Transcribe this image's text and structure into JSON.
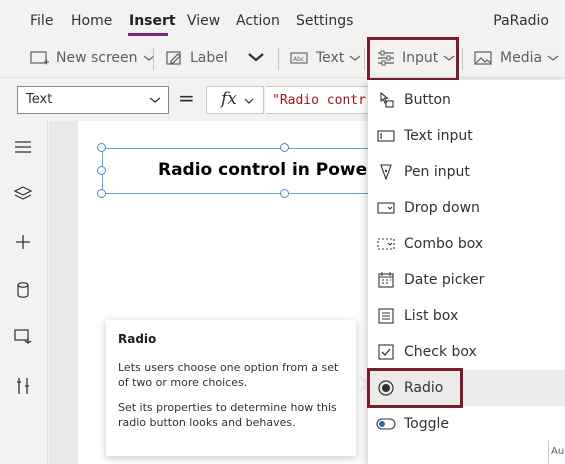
{
  "menu": {
    "items": [
      {
        "label": "File"
      },
      {
        "label": "Home"
      },
      {
        "label": "Insert"
      },
      {
        "label": "View"
      },
      {
        "label": "Action"
      },
      {
        "label": "Settings"
      }
    ],
    "active": "Insert",
    "app_name": "PaRadio"
  },
  "toolbar": {
    "new_screen": "New screen",
    "label": "Label",
    "text": "Text",
    "input": "Input",
    "media": "Media"
  },
  "formula": {
    "property": "Text",
    "equals": "=",
    "fx": "fx",
    "value": "\"Radio contr"
  },
  "canvas": {
    "label_text": "Radio control in Power"
  },
  "tooltip": {
    "title": "Radio",
    "p1": "Lets users choose one option from a set of two or more choices.",
    "p2": "Set its properties to determine how this radio button looks and behaves."
  },
  "input_menu": {
    "items": [
      {
        "label": "Button",
        "icon": "button-icon"
      },
      {
        "label": "Text input",
        "icon": "text-input-icon"
      },
      {
        "label": "Pen input",
        "icon": "pen-input-icon"
      },
      {
        "label": "Drop down",
        "icon": "drop-down-icon"
      },
      {
        "label": "Combo box",
        "icon": "combo-box-icon"
      },
      {
        "label": "Date picker",
        "icon": "date-picker-icon"
      },
      {
        "label": "List box",
        "icon": "list-box-icon"
      },
      {
        "label": "Check box",
        "icon": "check-box-icon"
      },
      {
        "label": "Radio",
        "icon": "radio-icon"
      },
      {
        "label": "Toggle",
        "icon": "toggle-icon"
      }
    ],
    "selected": "Radio"
  },
  "status": {
    "partial": "Au"
  },
  "colors": {
    "accent": "#742774",
    "highlight": "#7a1e2c",
    "selection": "#6ca0dc"
  }
}
